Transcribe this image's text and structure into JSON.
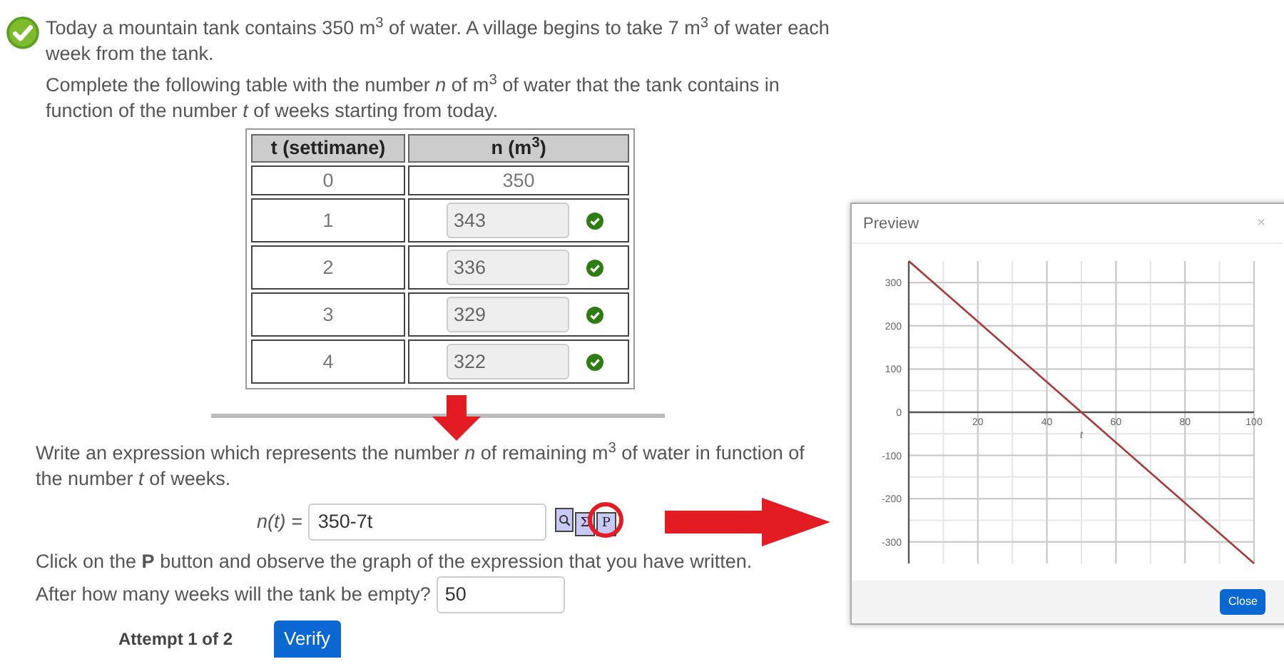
{
  "status": {
    "correct": true
  },
  "problem": {
    "paragraphs": [
      "Today a mountain tank contains 350 m$^{3}$ of water. A village begins to take 7 m$^{3}$ of water each week from the tank.",
      "Complete the following table with the number *n* of m$^{3}$ of water that the tank contains in function of the number *t* of weeks starting from today."
    ]
  },
  "table": {
    "columns": [
      "t (settimane)",
      "n (m$^{3}$)"
    ],
    "rows": [
      {
        "kind": "given",
        "t": "0",
        "n": "350"
      },
      {
        "kind": "input",
        "t": "1",
        "n": "343",
        "correct": true
      },
      {
        "kind": "input",
        "t": "2",
        "n": "336",
        "correct": true
      },
      {
        "kind": "input",
        "t": "3",
        "n": "329",
        "correct": true
      },
      {
        "kind": "input",
        "t": "4",
        "n": "322",
        "correct": true
      }
    ]
  },
  "expression": {
    "prompt": "Write an expression which represents the number *n* of remaining m$^{3}$ of water in function of the number *t* of weeks.",
    "label": "n(t) =",
    "value": "350-7t",
    "tools": [
      {
        "kind": "magnifier",
        "highlighted": false
      },
      {
        "kind": "letter",
        "glyph": "Σ",
        "highlighted": false
      },
      {
        "kind": "letter",
        "glyph": "P",
        "highlighted": true
      }
    ]
  },
  "instruction": "Click on the **P** button and observe the graph of the expression that you have written.",
  "question": {
    "label": "After how many weeks will the tank be empty?",
    "value": "50"
  },
  "attempt": "Attempt 1 of 2",
  "verify_button": "Verify",
  "preview": {
    "title": "Preview",
    "close_icon": "×",
    "close_button": "Close",
    "chart_data": {
      "type": "line",
      "xlabel": "t",
      "x": [
        0,
        100
      ],
      "series": [
        {
          "color": "#a83a3a",
          "values": [
            350,
            -350
          ]
        }
      ],
      "grid": true,
      "xlim": [
        0,
        100
      ],
      "ylim": [
        -350,
        350
      ],
      "xticks": [
        20,
        40,
        60,
        80,
        100
      ],
      "yticks": [
        -300,
        -200,
        -100,
        0,
        100,
        200,
        300
      ]
    }
  }
}
